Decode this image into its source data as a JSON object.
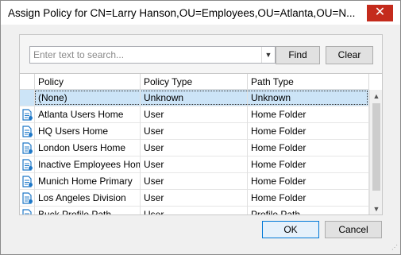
{
  "window": {
    "title": "Assign Policy for CN=Larry Hanson,OU=Employees,OU=Atlanta,OU=N...",
    "close_glyph": "✕"
  },
  "search": {
    "placeholder": "Enter text to search...",
    "value": "",
    "dropdown_glyph": "▼",
    "find_label": "Find",
    "clear_label": "Clear"
  },
  "grid": {
    "columns": [
      "Policy",
      "Policy Type",
      "Path Type"
    ],
    "rows": [
      {
        "icon": "",
        "policy": "(None)",
        "policy_type": "Unknown",
        "path_type": "Unknown",
        "selected": true
      },
      {
        "icon": "policy-document-icon",
        "policy": "Atlanta Users Home",
        "policy_type": "User",
        "path_type": "Home Folder"
      },
      {
        "icon": "policy-document-icon",
        "policy": "HQ Users Home",
        "policy_type": "User",
        "path_type": "Home Folder"
      },
      {
        "icon": "policy-document-icon",
        "policy": "London Users Home",
        "policy_type": "User",
        "path_type": "Home Folder"
      },
      {
        "icon": "policy-document-icon",
        "policy": "Inactive Employees Home",
        "policy_type": "User",
        "path_type": "Home Folder"
      },
      {
        "icon": "policy-document-icon",
        "policy": "Munich Home Primary",
        "policy_type": "User",
        "path_type": "Home Folder"
      },
      {
        "icon": "policy-document-icon",
        "policy": "Los Angeles Division",
        "policy_type": "User",
        "path_type": "Home Folder"
      },
      {
        "icon": "policy-document-icon",
        "policy": "Buck Profile Path",
        "policy_type": "User",
        "path_type": "Profile Path"
      }
    ],
    "scroll_up_glyph": "▲",
    "scroll_down_glyph": "▼"
  },
  "footer": {
    "ok_label": "OK",
    "cancel_label": "Cancel"
  },
  "colors": {
    "selected_row": "#cce4f7",
    "icon_blue": "#1e78c8",
    "close_red": "#c42b1c"
  }
}
